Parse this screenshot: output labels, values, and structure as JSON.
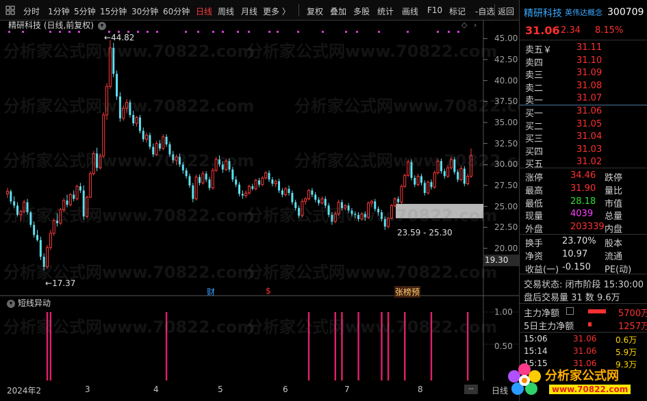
{
  "toolbar": {
    "items": [
      "分时",
      "1分钟",
      "5分钟",
      "15分钟",
      "30分钟",
      "60分钟",
      "日线",
      "周线",
      "月线",
      "更多 〉",
      "复权",
      "叠加",
      "多股",
      "统计",
      "画线",
      "F10",
      "标记",
      "-自选",
      "返回"
    ],
    "active": "日线"
  },
  "chart": {
    "title": "精研科技 (日线,前复权)",
    "low_label": "17.37",
    "high_label": "44.82",
    "range_label": "23.59 - 25.30",
    "current_price_box": "19.30",
    "y_ticks": [
      "45.00",
      "42.50",
      "40.00",
      "37.50",
      "35.00",
      "32.50",
      "30.00",
      "27.50",
      "25.00",
      "22.50",
      "20.00"
    ],
    "markers": {
      "cai": "财",
      "dollar": "$",
      "zhang": "张榜预"
    },
    "sub_title": "短线异动",
    "sub_y_ticks": [
      "1.00",
      "0.50"
    ],
    "x_ticks": [
      "2024年2",
      "3",
      "4",
      "5",
      "6",
      "7",
      "8"
    ],
    "x_axis_end": "日线",
    "scroll": "--",
    "watermark": "分析家公式网www.70822.com"
  },
  "chart_data": {
    "type": "candlestick",
    "title": "精研科技 (日线,前复权)",
    "ylim": [
      16.0,
      46.5
    ],
    "candles": [
      [
        26.5,
        27.2,
        26.0,
        26.8
      ],
      [
        26.8,
        27.0,
        25.3,
        25.6
      ],
      [
        25.6,
        26.2,
        24.8,
        25.1
      ],
      [
        25.1,
        25.5,
        23.8,
        24.0
      ],
      [
        24.0,
        24.6,
        23.2,
        24.4
      ],
      [
        24.4,
        25.8,
        24.2,
        25.5
      ],
      [
        25.5,
        25.9,
        24.0,
        24.3
      ],
      [
        24.3,
        24.5,
        22.5,
        22.8
      ],
      [
        22.8,
        23.2,
        21.3,
        21.6
      ],
      [
        21.6,
        22.2,
        20.8,
        21.0
      ],
      [
        21.0,
        21.4,
        18.6,
        19.0
      ],
      [
        19.0,
        19.4,
        17.37,
        17.8
      ],
      [
        17.8,
        20.4,
        17.6,
        20.1
      ],
      [
        20.1,
        22.2,
        19.8,
        21.8
      ],
      [
        21.8,
        23.6,
        21.5,
        23.3
      ],
      [
        23.3,
        24.2,
        22.6,
        23.0
      ],
      [
        23.0,
        24.8,
        22.8,
        24.6
      ],
      [
        24.6,
        26.0,
        24.3,
        25.7
      ],
      [
        25.7,
        26.4,
        24.9,
        25.2
      ],
      [
        25.2,
        26.6,
        25.0,
        26.4
      ],
      [
        26.4,
        26.9,
        25.6,
        25.9
      ],
      [
        25.9,
        27.6,
        25.7,
        27.4
      ],
      [
        27.4,
        27.8,
        26.6,
        26.9
      ],
      [
        26.9,
        27.5,
        23.4,
        23.8
      ],
      [
        23.8,
        26.3,
        23.6,
        26.1
      ],
      [
        26.1,
        29.2,
        26.0,
        28.9
      ],
      [
        28.9,
        31.6,
        28.7,
        31.3
      ],
      [
        31.3,
        32.0,
        29.2,
        29.6
      ],
      [
        29.6,
        31.3,
        29.4,
        31.0
      ],
      [
        31.0,
        36.2,
        30.8,
        35.9
      ],
      [
        35.9,
        39.7,
        35.3,
        39.3
      ],
      [
        39.3,
        44.82,
        39.0,
        43.9
      ],
      [
        43.9,
        44.5,
        40.4,
        40.8
      ],
      [
        40.8,
        41.2,
        37.7,
        38.1
      ],
      [
        38.1,
        38.6,
        35.1,
        35.5
      ],
      [
        35.5,
        37.0,
        35.2,
        36.7
      ],
      [
        36.7,
        37.8,
        36.1,
        37.4
      ],
      [
        37.4,
        37.7,
        35.6,
        35.9
      ],
      [
        35.9,
        36.4,
        34.6,
        34.9
      ],
      [
        34.9,
        35.8,
        34.5,
        35.6
      ],
      [
        35.6,
        35.9,
        33.7,
        34.0
      ],
      [
        34.0,
        34.4,
        32.7,
        33.0
      ],
      [
        33.0,
        33.8,
        32.6,
        33.5
      ],
      [
        33.5,
        33.8,
        31.8,
        32.1
      ],
      [
        32.1,
        32.5,
        30.9,
        31.2
      ],
      [
        31.2,
        32.8,
        31.0,
        32.5
      ],
      [
        32.5,
        32.9,
        31.6,
        31.9
      ],
      [
        31.9,
        33.6,
        31.7,
        33.3
      ],
      [
        33.3,
        33.6,
        32.1,
        32.4
      ],
      [
        32.4,
        32.7,
        30.9,
        31.2
      ],
      [
        31.2,
        31.6,
        30.2,
        30.5
      ],
      [
        30.5,
        31.2,
        29.9,
        30.9
      ],
      [
        30.9,
        31.3,
        29.7,
        30.0
      ],
      [
        30.0,
        30.3,
        28.9,
        29.3
      ],
      [
        29.3,
        29.6,
        28.3,
        28.6
      ],
      [
        28.6,
        28.9,
        27.2,
        27.5
      ],
      [
        27.5,
        27.8,
        25.5,
        25.9
      ],
      [
        25.9,
        28.8,
        25.7,
        28.5
      ],
      [
        28.5,
        28.8,
        27.5,
        27.8
      ],
      [
        27.8,
        29.2,
        27.6,
        28.9
      ],
      [
        28.9,
        29.2,
        27.9,
        28.2
      ],
      [
        28.2,
        28.5,
        26.9,
        27.2
      ],
      [
        27.2,
        29.6,
        27.0,
        29.3
      ],
      [
        29.3,
        30.9,
        29.1,
        30.6
      ],
      [
        30.6,
        31.1,
        29.7,
        30.0
      ],
      [
        30.0,
        30.4,
        29.0,
        29.4
      ],
      [
        29.4,
        30.7,
        29.2,
        30.4
      ],
      [
        30.4,
        30.7,
        29.1,
        29.4
      ],
      [
        29.4,
        29.7,
        27.9,
        28.2
      ],
      [
        28.2,
        28.6,
        27.3,
        27.6
      ],
      [
        27.6,
        27.9,
        26.2,
        26.5
      ],
      [
        26.5,
        26.9,
        25.9,
        26.3
      ],
      [
        26.3,
        26.9,
        26.0,
        26.6
      ],
      [
        26.6,
        27.6,
        26.4,
        27.4
      ],
      [
        27.4,
        27.7,
        26.9,
        27.1
      ],
      [
        27.1,
        28.3,
        26.9,
        28.1
      ],
      [
        28.1,
        28.4,
        27.3,
        27.6
      ],
      [
        27.6,
        28.6,
        27.4,
        28.4
      ],
      [
        28.4,
        29.2,
        28.2,
        29.0
      ],
      [
        29.0,
        29.3,
        27.9,
        28.2
      ],
      [
        28.2,
        28.5,
        27.4,
        27.7
      ],
      [
        27.7,
        28.2,
        27.3,
        28.0
      ],
      [
        28.0,
        28.3,
        26.6,
        26.9
      ],
      [
        26.9,
        27.2,
        26.1,
        26.4
      ],
      [
        26.4,
        27.3,
        26.2,
        27.1
      ],
      [
        27.1,
        27.5,
        26.3,
        26.6
      ],
      [
        26.6,
        26.9,
        25.2,
        25.5
      ],
      [
        25.5,
        25.8,
        24.5,
        24.8
      ],
      [
        24.8,
        25.1,
        23.6,
        23.9
      ],
      [
        23.9,
        25.9,
        23.7,
        25.6
      ],
      [
        25.6,
        26.1,
        25.2,
        25.9
      ],
      [
        25.9,
        27.1,
        25.7,
        26.9
      ],
      [
        26.9,
        27.2,
        26.1,
        26.4
      ],
      [
        26.4,
        26.7,
        25.5,
        25.8
      ],
      [
        25.8,
        26.1,
        25.1,
        25.4
      ],
      [
        25.4,
        26.2,
        25.2,
        25.9
      ],
      [
        25.9,
        26.2,
        24.8,
        25.1
      ],
      [
        25.1,
        25.4,
        23.7,
        24.0
      ],
      [
        24.0,
        24.3,
        22.8,
        23.2
      ],
      [
        23.2,
        24.4,
        23.0,
        24.1
      ],
      [
        24.1,
        25.8,
        23.9,
        25.5
      ],
      [
        25.5,
        25.8,
        24.5,
        24.8
      ],
      [
        24.8,
        25.3,
        24.5,
        25.1
      ],
      [
        25.1,
        25.4,
        24.2,
        24.5
      ],
      [
        24.5,
        24.8,
        23.8,
        24.1
      ],
      [
        24.1,
        24.4,
        23.6,
        24.0
      ],
      [
        24.0,
        24.3,
        23.2,
        23.5
      ],
      [
        23.5,
        24.3,
        23.3,
        24.1
      ],
      [
        24.1,
        24.4,
        23.3,
        23.7
      ],
      [
        23.7,
        25.6,
        23.5,
        25.4
      ],
      [
        25.4,
        25.8,
        24.9,
        25.6
      ],
      [
        25.6,
        25.9,
        24.4,
        24.7
      ],
      [
        24.7,
        25.0,
        23.9,
        24.3
      ],
      [
        24.3,
        24.6,
        23.2,
        23.5
      ],
      [
        23.5,
        23.8,
        22.2,
        22.6
      ],
      [
        22.6,
        23.7,
        22.4,
        23.6
      ],
      [
        23.6,
        25.3,
        23.4,
        25.1
      ],
      [
        25.1,
        26.1,
        24.9,
        25.9
      ],
      [
        25.9,
        26.2,
        25.3,
        25.5
      ],
      [
        25.5,
        27.6,
        25.3,
        27.4
      ],
      [
        27.4,
        28.9,
        27.2,
        28.7
      ],
      [
        28.7,
        30.6,
        28.5,
        30.3
      ],
      [
        30.3,
        30.6,
        28.1,
        28.4
      ],
      [
        28.4,
        28.7,
        27.3,
        27.6
      ],
      [
        27.6,
        28.9,
        27.4,
        28.6
      ],
      [
        28.6,
        28.9,
        27.5,
        27.8
      ],
      [
        27.8,
        28.1,
        26.3,
        26.6
      ],
      [
        26.6,
        28.1,
        26.4,
        27.9
      ],
      [
        27.9,
        28.2,
        27.0,
        27.3
      ],
      [
        27.3,
        29.3,
        27.1,
        29.0
      ],
      [
        29.0,
        30.7,
        28.8,
        30.4
      ],
      [
        30.4,
        30.7,
        28.9,
        29.2
      ],
      [
        29.2,
        29.5,
        28.3,
        28.6
      ],
      [
        28.6,
        29.9,
        28.4,
        29.6
      ],
      [
        29.6,
        30.9,
        29.4,
        30.6
      ],
      [
        30.6,
        30.9,
        28.8,
        29.1
      ],
      [
        29.1,
        29.4,
        27.9,
        28.2
      ],
      [
        28.2,
        29.8,
        28.0,
        29.5
      ],
      [
        29.5,
        29.8,
        27.4,
        27.7
      ],
      [
        27.7,
        28.9,
        27.5,
        28.6
      ],
      [
        28.6,
        31.9,
        28.4,
        31.06
      ]
    ],
    "signals": [
      12,
      13,
      48,
      91,
      99,
      101,
      106,
      113,
      115,
      120,
      128,
      139
    ]
  },
  "quote": {
    "name": "精研科技",
    "tag": "英伟达概念",
    "code": "300709",
    "price": "31.06",
    "change": "2.34",
    "pct": "8.15%",
    "sells": [
      {
        "label": "卖五￥",
        "price": "31.11"
      },
      {
        "label": "卖四",
        "price": "31.10"
      },
      {
        "label": "卖三",
        "price": "31.09"
      },
      {
        "label": "卖二",
        "price": "31.08"
      },
      {
        "label": "卖一",
        "price": "31.07"
      }
    ],
    "buys": [
      {
        "label": "买一",
        "price": "31.06"
      },
      {
        "label": "买二",
        "price": "31.05"
      },
      {
        "label": "买三",
        "price": "31.04"
      },
      {
        "label": "买四",
        "price": "31.03"
      },
      {
        "label": "买五",
        "price": "31.02"
      }
    ],
    "stats": [
      {
        "label": "涨停",
        "value": "34.46",
        "color": "#ff3030",
        "label2": "跌停"
      },
      {
        "label": "最高",
        "value": "31.90",
        "color": "#ff3030",
        "label2": "量比"
      },
      {
        "label": "最低",
        "value": "28.18",
        "color": "#30e030",
        "label2": "市值"
      },
      {
        "label": "现量",
        "value": "4039",
        "color": "#ff40ff",
        "label2": "总量"
      },
      {
        "label": "外盘",
        "value": "203339",
        "color": "#ff3030",
        "label2": "内盘"
      }
    ],
    "stats2": [
      {
        "label": "换手",
        "value": "23.70%",
        "label2": "股本"
      },
      {
        "label": "净资",
        "value": "10.97",
        "label2": "流通"
      },
      {
        "label": "收益(一)",
        "value": "-0.150",
        "label2": "PE(动)"
      }
    ],
    "status_line": "交易状态: 闭市阶段  15:30:00",
    "after_line": "盘后交易量 31 数 9.6万",
    "flow1_label": "主力净额",
    "flow1_value": "5700万",
    "flow2_label": "5日主力净额",
    "flow2_value": "1257万",
    "ticks": [
      {
        "time": "15:06",
        "price": "31.06",
        "vol": "0.6万"
      },
      {
        "time": "15:14",
        "price": "31.06",
        "vol": "5.9万"
      },
      {
        "time": "15:15",
        "price": "31.06",
        "vol": "9.3万"
      }
    ]
  },
  "logo": {
    "text": "分析家公式网",
    "url": "www.70822.com"
  },
  "colors": {
    "up": "#ff3b3b",
    "down": "#5fe1f1",
    "signal": "#e0206b",
    "dot": "#d040d0"
  }
}
